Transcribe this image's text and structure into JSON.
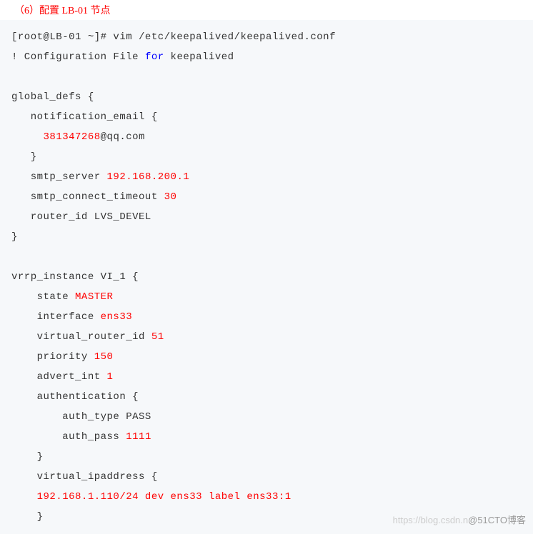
{
  "header": "（6）配置 LB-01 节点",
  "lines": {
    "l1_prompt": "[root@LB-01 ~]# vim /etc/keepalived/keepalived.conf",
    "l2a": "! Configuration File ",
    "l2b": "for",
    "l2c": " keepalived",
    "blank": " ",
    "l4": "global_defs {",
    "l5": "   notification_email {",
    "l6a": "     ",
    "l6b": "381347268",
    "l6c": "@qq.com",
    "l7": "   }",
    "l8a": "   smtp_server ",
    "l8b": "192.168.200.1",
    "l9a": "   smtp_connect_timeout ",
    "l9b": "30",
    "l10": "   router_id LVS_DEVEL",
    "l11": "}",
    "l13": "vrrp_instance VI_1 {",
    "l14a": "    state ",
    "l14b": "MASTER",
    "l15a": "    interface ",
    "l15b": "ens33",
    "l16a": "    virtual_router_id ",
    "l16b": "51",
    "l17a": "    priority ",
    "l17b": "150",
    "l18a": "    advert_int ",
    "l18b": "1",
    "l19": "    authentication {",
    "l20": "        auth_type PASS",
    "l21a": "        auth_pass ",
    "l21b": "1111",
    "l22": "    }",
    "l23": "    virtual_ipaddress {",
    "l24": "    192.168.1.110/24 dev ens33 label ens33:1",
    "l25": "    }"
  },
  "watermark": {
    "faded": "https://blog.csdn.n",
    "dark": "@51CTO博客"
  }
}
